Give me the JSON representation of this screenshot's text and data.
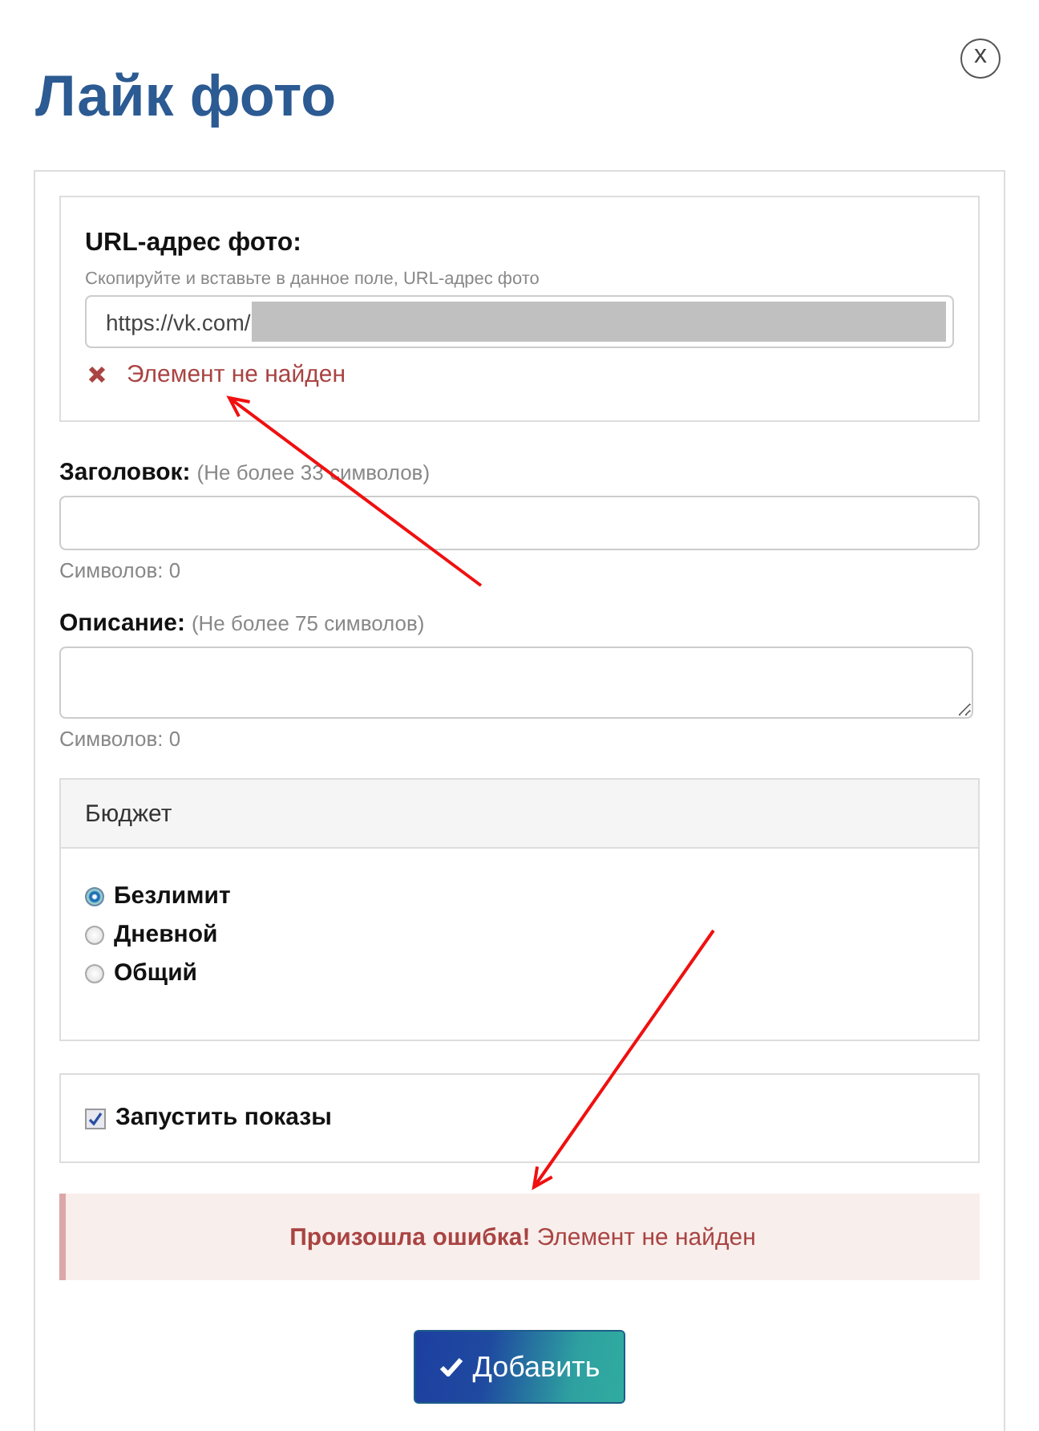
{
  "close_button": {
    "label": "x"
  },
  "title": "Лайк фото",
  "url_section": {
    "label": "URL-адрес фото:",
    "hint": "Скопируйте и вставьте в данное поле, URL-адрес фото",
    "value": "https://vk.com/",
    "redacted": true,
    "error": "Элемент не найден"
  },
  "fields": [
    {
      "kind": "input",
      "label": "Заголовок:",
      "note": "(Не более 33 символов)",
      "counter": "Символов: 0"
    },
    {
      "kind": "textarea",
      "label": "Описание:",
      "note": "(Не более 75 символов)",
      "counter": "Символов: 0"
    }
  ],
  "budget": {
    "title": "Бюджет",
    "options": [
      {
        "label": "Безлимит",
        "selected": true
      },
      {
        "label": "Дневной",
        "selected": false
      },
      {
        "label": "Общий",
        "selected": false
      }
    ]
  },
  "launch": {
    "label": "Запустить показы",
    "checked": true
  },
  "alert": {
    "text": "**Произошла ошибка!** Элемент не найден"
  },
  "submit_button": {
    "label": "Добавить"
  },
  "annotations": [
    {
      "kind": "arrow"
    },
    {
      "kind": "arrow"
    }
  ]
}
